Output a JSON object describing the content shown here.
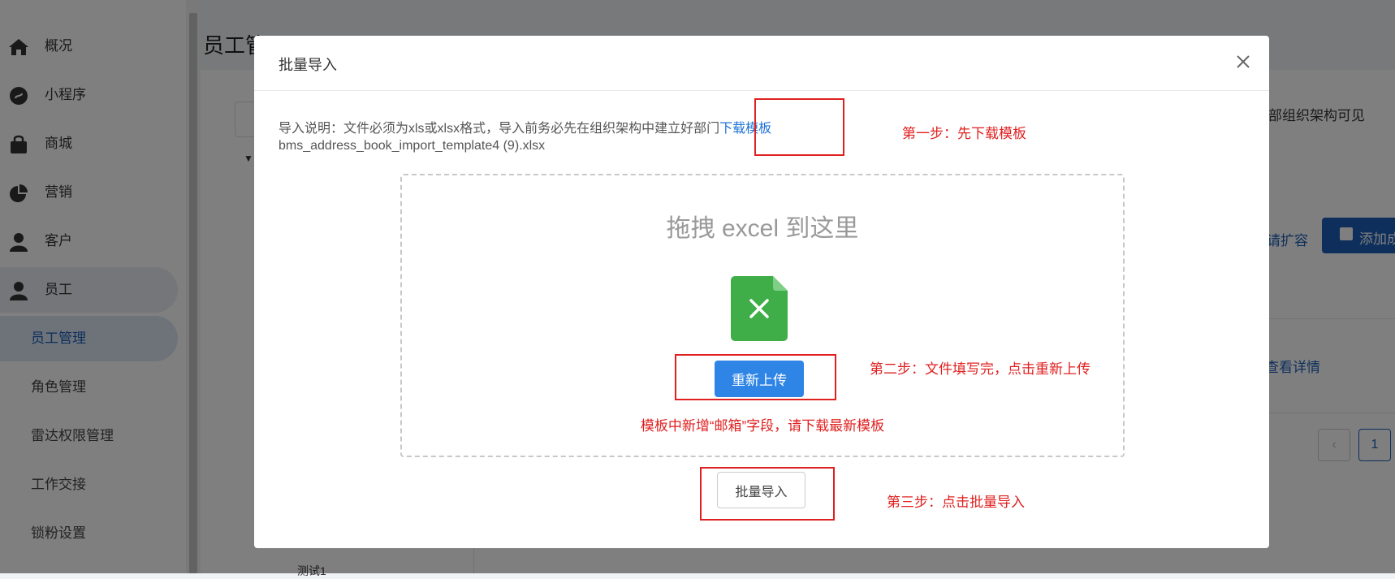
{
  "sidebar": {
    "items": [
      {
        "label": "概况",
        "icon": "home-icon"
      },
      {
        "label": "小程序",
        "icon": "miniprogram-icon"
      },
      {
        "label": "商城",
        "icon": "shopping-bag-icon"
      },
      {
        "label": "营销",
        "icon": "pie-chart-icon"
      },
      {
        "label": "客户",
        "icon": "customer-icon"
      },
      {
        "label": "员工",
        "icon": "user-icon"
      }
    ],
    "subitems": [
      {
        "label": "员工管理",
        "active": true
      },
      {
        "label": "角色管理"
      },
      {
        "label": "雷达权限管理"
      },
      {
        "label": "工作交接"
      },
      {
        "label": "锁粉设置"
      }
    ]
  },
  "background": {
    "page_title": "员工管",
    "visible_text": "部组织架构可见",
    "expand_link": "请扩容",
    "add_button": "添加成",
    "detail_link": "查看详情",
    "page_number": "1",
    "tree_item": "测试1"
  },
  "modal": {
    "title": "批量导入",
    "close_icon": "close-icon",
    "description": "导入说明：文件必须为xls或xlsx格式，导入前务必先在组织架构中建立好部门",
    "download_link": "下载模板",
    "filename": "bms_address_book_import_template4 (9).xlsx",
    "drop_title": "拖拽 excel 到这里",
    "excel_icon": "excel-file-icon",
    "reupload_label": "重新上传",
    "notice": "模板中新增“邮箱”字段，请下载最新模板",
    "import_label": "批量导入"
  },
  "annotations": {
    "step1": "第一步：先下载模板",
    "step2": "第二步：文件填写完，点击重新上传",
    "step3": "第三步：点击批量导入",
    "color": "#e02020"
  },
  "colors": {
    "accent": "#1d73d6",
    "button_primary": "#2f85e6",
    "excel_green": "#3fae49"
  }
}
